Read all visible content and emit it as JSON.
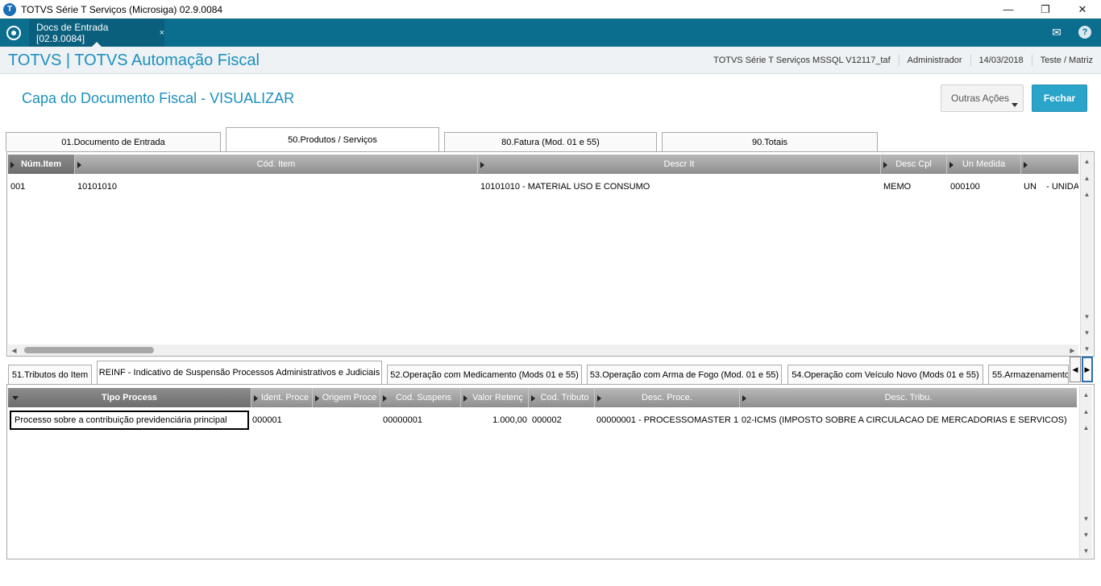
{
  "window": {
    "title": "TOTVS Série T Serviços (Microsiga) 02.9.0084",
    "minimize": "—",
    "maximize": "❐",
    "close": "✕"
  },
  "tabbar": {
    "doc_tab_label": "Docs de Entrada [02.9.0084]",
    "doc_tab_close": "×",
    "mail_icon": "✉",
    "help_icon": "?"
  },
  "header": {
    "app_name": "TOTVS | TOTVS Automação Fiscal",
    "environment": "TOTVS Série T Serviços MSSQL V12117_taf",
    "user": "Administrador",
    "date": "14/03/2018",
    "branch": "Teste / Matriz"
  },
  "page": {
    "title": "Capa do Documento Fiscal - VISUALIZAR",
    "outras_acoes": "Outras Ações",
    "fechar": "Fechar"
  },
  "main_tabs": [
    {
      "label": "01.Documento de Entrada"
    },
    {
      "label": "50.Produtos / Serviços"
    },
    {
      "label": "80.Fatura (Mod. 01 e 55)"
    },
    {
      "label": "90.Totais"
    }
  ],
  "items_grid": {
    "columns": [
      "Núm.Item",
      "Cód. Item",
      "Descr It",
      "Desc Cpl",
      "Un Medida",
      ""
    ],
    "rows": [
      {
        "num": "001",
        "cod": "10101010",
        "descr": "10101010 - MATERIAL USO E CONSUMO",
        "desc_cpl": "MEMO",
        "un_medida": "000100",
        "extra": "UN    - UNIDA"
      }
    ]
  },
  "sub_tabs": [
    {
      "label": "51.Tributos do Item"
    },
    {
      "label": "REINF - Indicativo de Suspensão Processos Administrativos e Judiciais"
    },
    {
      "label": "52.Operação com Medicamento (Mods 01 e 55)"
    },
    {
      "label": "53.Operação com Arma de Fogo (Mod. 01 e 55)"
    },
    {
      "label": "54.Operação com Veículo Novo (Mods 01 e 55)"
    },
    {
      "label": "55.Armazenamento"
    }
  ],
  "reinf_grid": {
    "columns": [
      "Tipo Process",
      "Ident. Proce",
      "Origem Proce",
      "Cod. Suspens",
      "Valor Retenç",
      "Cod. Tributo",
      "Desc. Proce.",
      "Desc. Tribu."
    ],
    "rows": [
      {
        "tipo": "Processo sobre a contribuição previdenciária principal",
        "ident": "000001",
        "origem": "",
        "cod_susp": "00000001",
        "valor": "1.000,00",
        "cod_trib": "000002",
        "desc_proc": "00000001 - PROCESSOMASTER 1",
        "desc_trib": "02-ICMS (IMPOSTO SOBRE A CIRCULACAO DE MERCADORIAS E SERVICOS)"
      }
    ]
  }
}
